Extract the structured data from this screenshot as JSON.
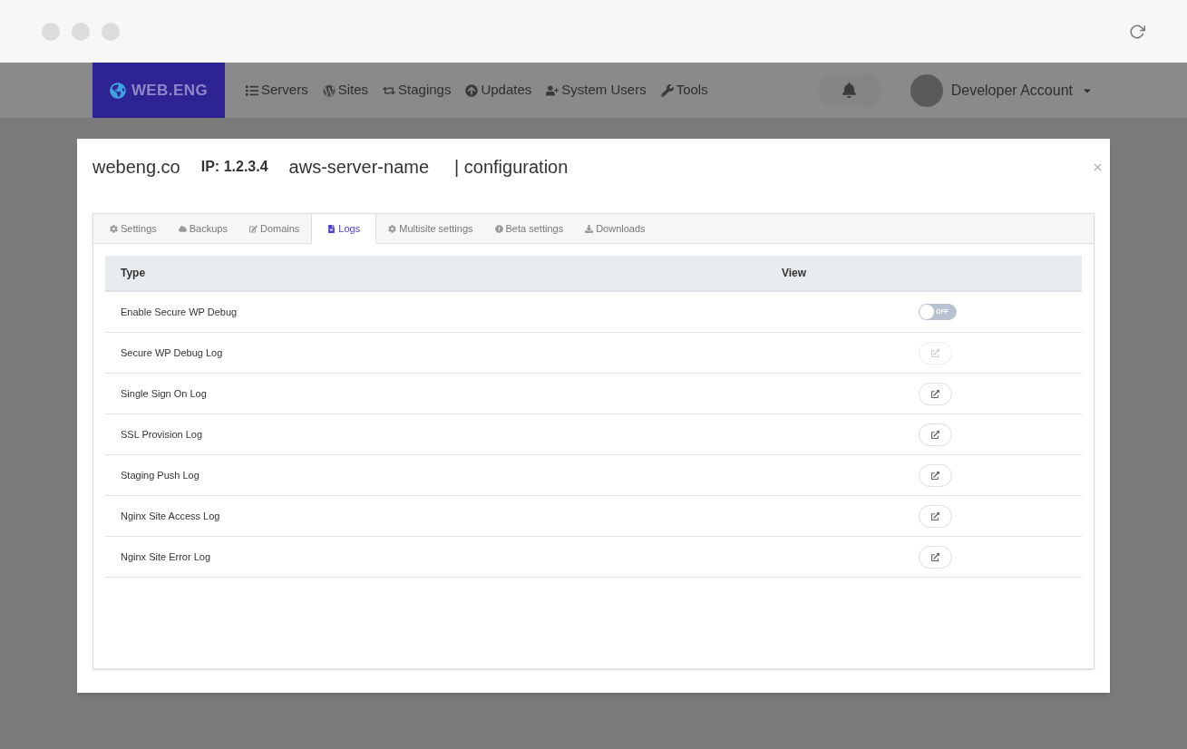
{
  "nav": {
    "brand": "WEB.ENG",
    "items": [
      {
        "label": "Servers"
      },
      {
        "label": "Sites"
      },
      {
        "label": "Stagings"
      },
      {
        "label": "Updates"
      },
      {
        "label": "System Users"
      },
      {
        "label": "Tools"
      }
    ],
    "account": "Developer Account"
  },
  "modal": {
    "title": {
      "site": "webeng.co",
      "ip": "IP: 1.2.3.4",
      "server": "aws-server-name",
      "section": "| configuration"
    },
    "tabs": [
      {
        "label": "Settings",
        "selected": false
      },
      {
        "label": "Backups",
        "selected": false
      },
      {
        "label": "Domains",
        "selected": false
      },
      {
        "label": "Logs",
        "selected": true
      },
      {
        "label": "Multisite settings",
        "selected": false
      },
      {
        "label": "Beta settings",
        "selected": false
      },
      {
        "label": "Downloads",
        "selected": false
      }
    ],
    "table": {
      "columns": [
        "Type",
        "View"
      ],
      "rows": [
        {
          "type": "Enable Secure WP Debug",
          "kind": "toggle",
          "on": false,
          "toggle_label": "OFF"
        },
        {
          "type": "Secure WP Debug Log",
          "kind": "link",
          "disabled": true
        },
        {
          "type": "Single Sign On Log",
          "kind": "link",
          "disabled": false
        },
        {
          "type": "SSL Provision Log",
          "kind": "link",
          "disabled": false
        },
        {
          "type": "Staging Push Log",
          "kind": "link",
          "disabled": false
        },
        {
          "type": "Nginx Site Access Log",
          "kind": "link",
          "disabled": false
        },
        {
          "type": "Nginx Site Error Log",
          "kind": "link",
          "disabled": false
        }
      ]
    }
  }
}
